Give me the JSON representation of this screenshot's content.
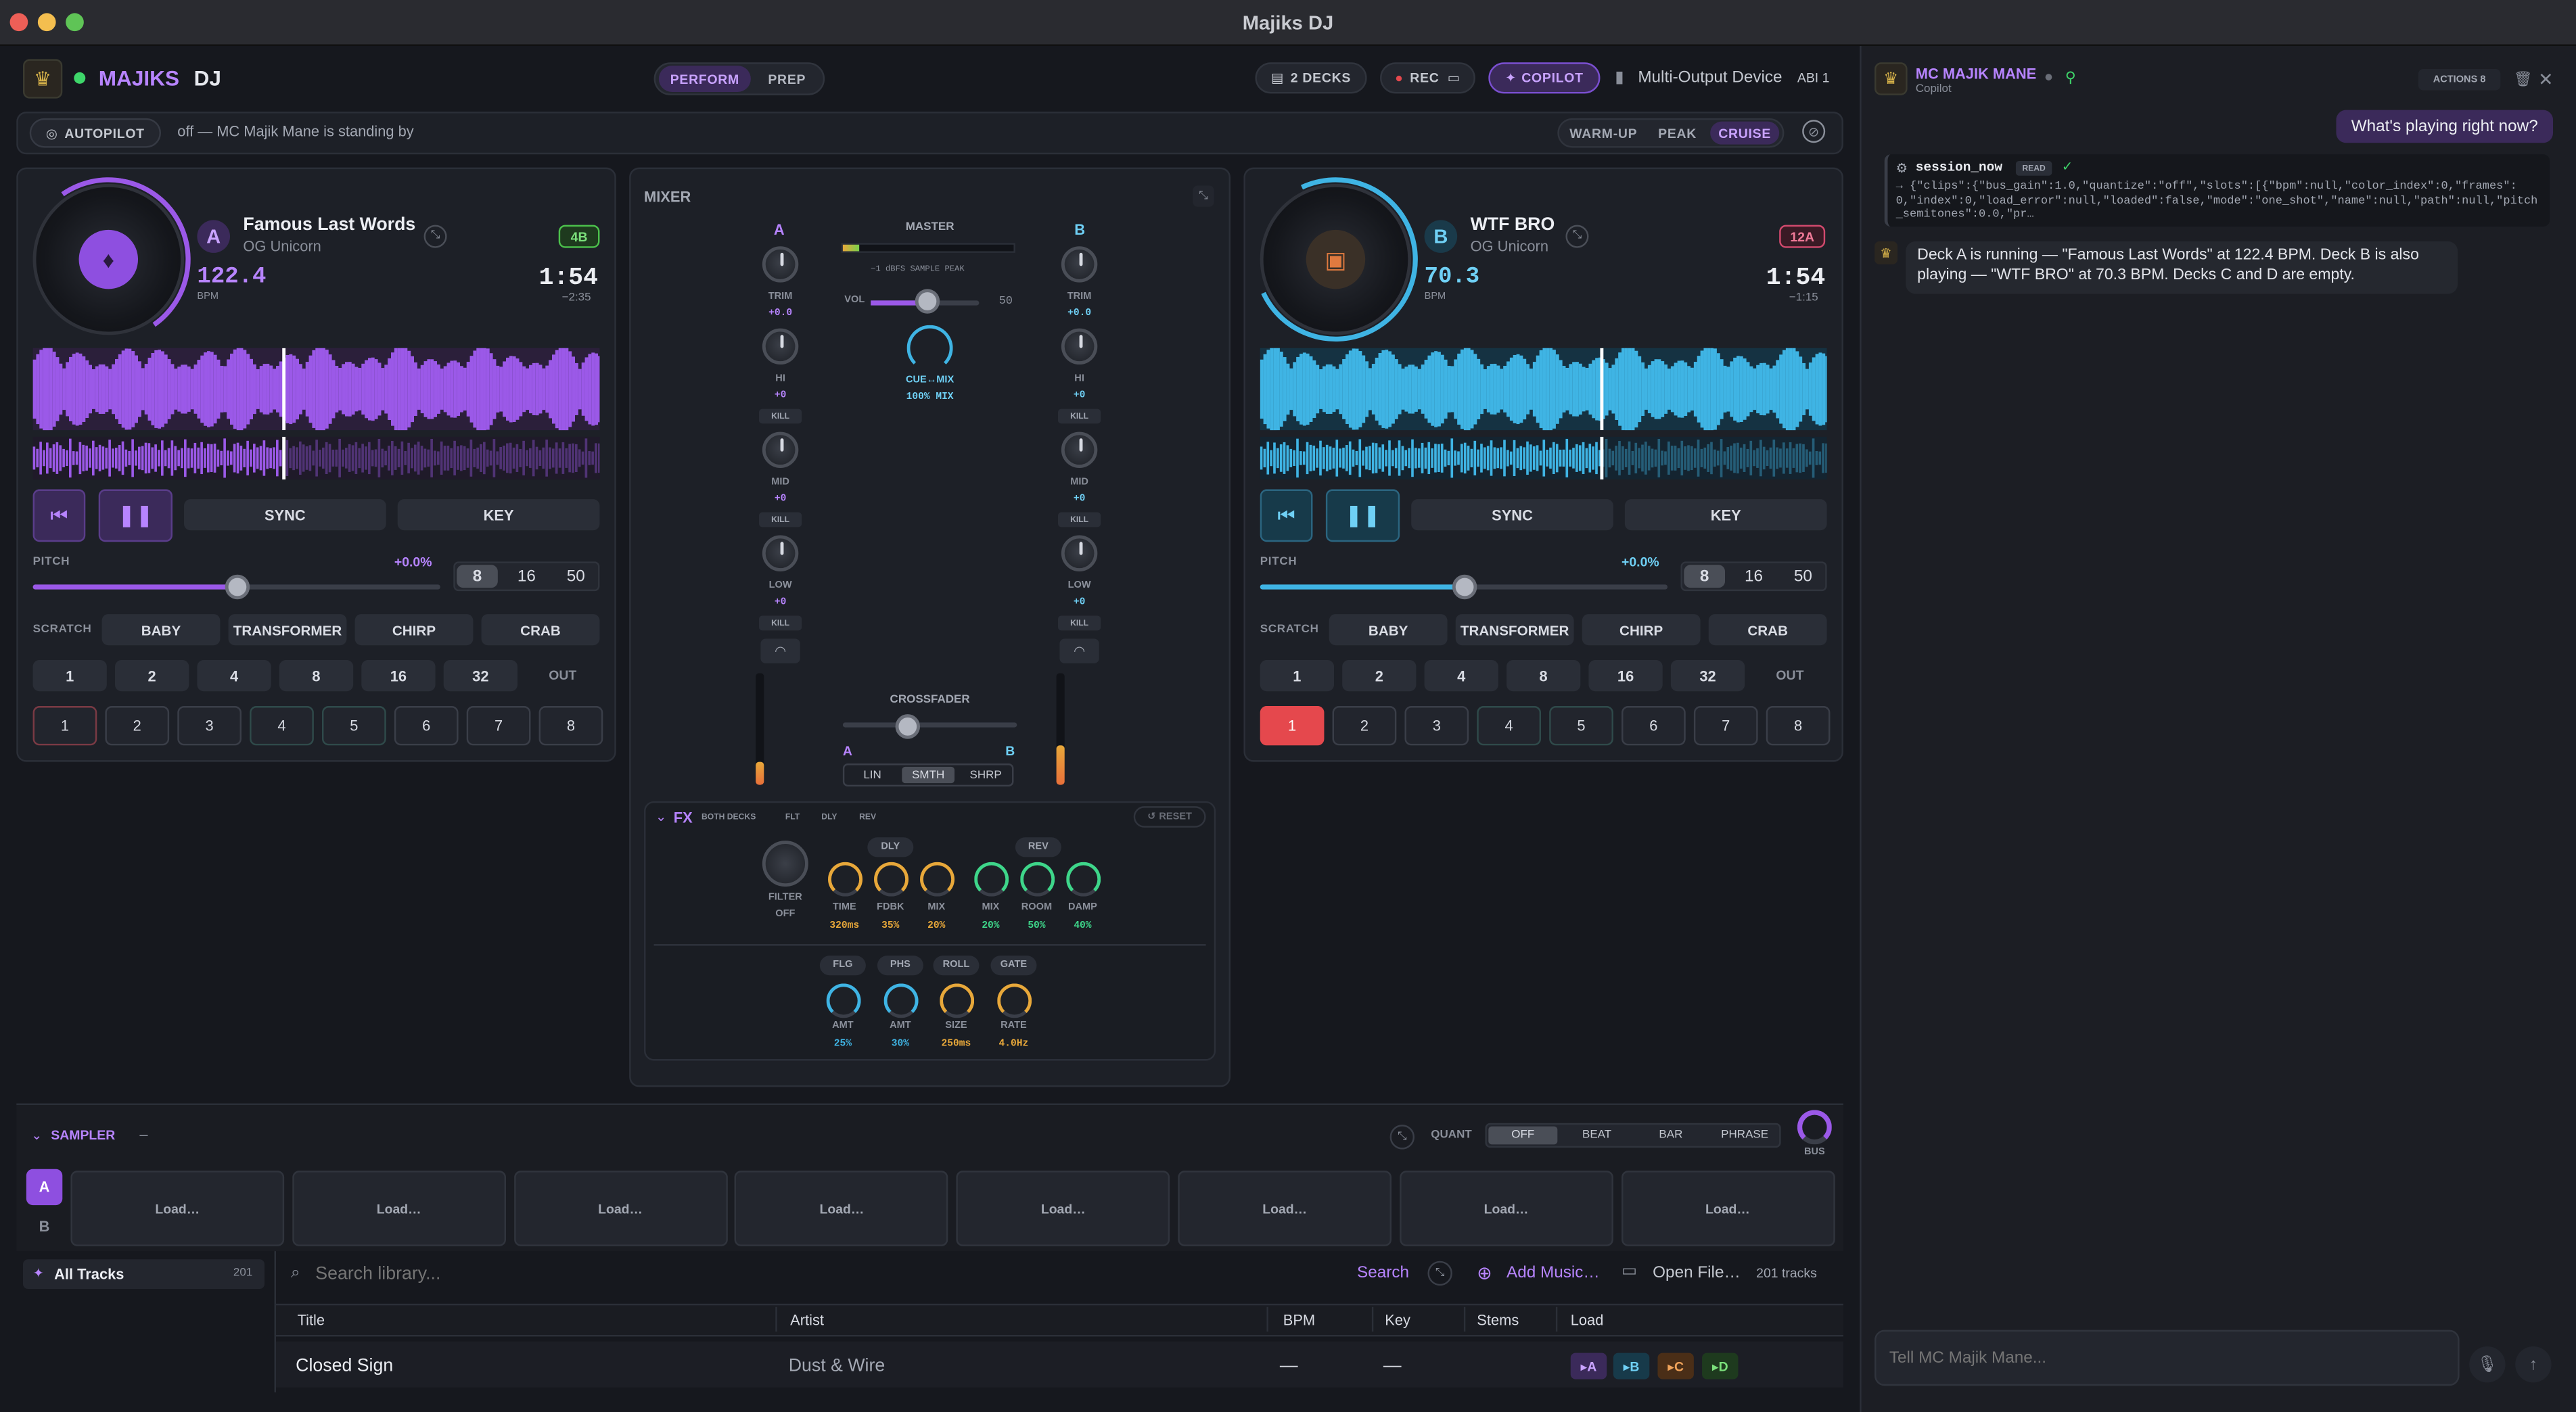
{
  "window": {
    "title": "Majiks DJ"
  },
  "header": {
    "brand": "MAJIKS",
    "brand2": "DJ",
    "mode_perform": "PERFORM",
    "mode_prep": "PREP",
    "decks": "2 DECKS",
    "rec": "REC",
    "copilot": "COPILOT",
    "device": "Multi-Output Device",
    "abi": "ABI 1"
  },
  "autopilot": {
    "label": "AUTOPILOT",
    "status": "off — MC Majik Mane is standing by",
    "modes": [
      "WARM-UP",
      "PEAK",
      "CRUISE"
    ]
  },
  "deckA": {
    "letter": "A",
    "title": "Famous Last Words",
    "artist": "OG Unicorn",
    "key": "4B",
    "bpm": "122.4",
    "bpm_label": "BPM",
    "time": "1:54",
    "remaining": "−2:35",
    "color": "#9b59e8",
    "sync": "SYNC",
    "key_btn": "KEY",
    "pitch_label": "PITCH",
    "pitch_val": "+0.0%",
    "ranges": [
      "8",
      "16",
      "50"
    ],
    "scratch_label": "SCRATCH",
    "scratch": [
      "BABY",
      "TRANSFORMER",
      "CHIRP",
      "CRAB"
    ],
    "loops": [
      "1",
      "2",
      "4",
      "8",
      "16",
      "32",
      "OUT"
    ],
    "cues": [
      "1",
      "2",
      "3",
      "4",
      "5",
      "6",
      "7",
      "8"
    ],
    "progress": 0.44,
    "pitch_pos": 0.5
  },
  "deckB": {
    "letter": "B",
    "title": "WTF BRO",
    "artist": "OG Unicorn",
    "key": "12A",
    "bpm": "70.3",
    "bpm_label": "BPM",
    "time": "1:54",
    "remaining": "−1:15",
    "color": "#3fb4e4",
    "sync": "SYNC",
    "key_btn": "KEY",
    "pitch_label": "PITCH",
    "pitch_val": "+0.0%",
    "ranges": [
      "8",
      "16",
      "50"
    ],
    "scratch_label": "SCRATCH",
    "scratch": [
      "BABY",
      "TRANSFORMER",
      "CHIRP",
      "CRAB"
    ],
    "loops": [
      "1",
      "2",
      "4",
      "8",
      "16",
      "32",
      "OUT"
    ],
    "cues": [
      "1",
      "2",
      "3",
      "4",
      "5",
      "6",
      "7",
      "8"
    ],
    "progress": 0.6,
    "pitch_pos": 0.5
  },
  "mixer": {
    "title": "MIXER",
    "a": "A",
    "b": "B",
    "master": "MASTER",
    "dbfs": "−1 dBFS SAMPLE PEAK",
    "vol": "VOL",
    "vol_val": "50",
    "cue_mix": "CUE↔MIX",
    "cue_mix_val": "100% MIX",
    "trim": "TRIM",
    "trim_val": "+0.0",
    "hi": "HI",
    "mid": "MID",
    "low": "LOW",
    "eq_val": "+0",
    "kill": "KILL",
    "crossfader": "CROSSFADER",
    "curves": [
      "LIN",
      "SMTH",
      "SHRP"
    ]
  },
  "fx": {
    "title": "FX",
    "tabs": [
      "BOTH DECKS",
      "FLT",
      "DLY",
      "REV"
    ],
    "reset": "RESET",
    "filter": "FILTER",
    "filter_val": "OFF",
    "dly": "DLY",
    "rev": "REV",
    "knobs1": [
      {
        "l": "TIME",
        "v": "320ms"
      },
      {
        "l": "FDBK",
        "v": "35%"
      },
      {
        "l": "MIX",
        "v": "20%"
      },
      {
        "l": "MIX",
        "v": "20%"
      },
      {
        "l": "ROOM",
        "v": "50%"
      },
      {
        "l": "DAMP",
        "v": "40%"
      }
    ],
    "groups2": [
      "FLG",
      "PHS",
      "ROLL",
      "GATE"
    ],
    "knobs2": [
      {
        "l": "AMT",
        "v": "25%"
      },
      {
        "l": "AMT",
        "v": "30%"
      },
      {
        "l": "SIZE",
        "v": "250ms"
      },
      {
        "l": "RATE",
        "v": "4.0Hz"
      }
    ]
  },
  "sampler": {
    "title": "SAMPLER",
    "dash": "–",
    "quant": "QUANT",
    "quant_opts": [
      "OFF",
      "BEAT",
      "BAR",
      "PHRASE"
    ],
    "bus": "BUS",
    "banks": [
      "A",
      "B"
    ],
    "slots": [
      "Load…",
      "Load…",
      "Load…",
      "Load…",
      "Load…",
      "Load…",
      "Load…",
      "Load…"
    ]
  },
  "library": {
    "all_tracks": "All Tracks",
    "count": "201",
    "search_placeholder": "Search library...",
    "search_btn": "Search",
    "add_music": "Add Music…",
    "open_file": "Open File…",
    "tracks": "201 tracks",
    "cols": [
      "Title",
      "Artist",
      "BPM",
      "Key",
      "Stems",
      "Load"
    ],
    "rows": [
      {
        "title": "Closed Sign",
        "artist": "Dust & Wire",
        "bpm": "—",
        "key": "—",
        "loads": [
          "▸A",
          "▸B",
          "▸C",
          "▸D"
        ]
      }
    ]
  },
  "copilot": {
    "name": "MC MAJIK MANE",
    "sub": "Copilot",
    "actions": "ACTIONS 8",
    "user_msg": "What's playing right now?",
    "tool": "session_now",
    "tool_badge": "READ",
    "tool_json": "→ {\"clips\":{\"bus_gain\":1.0,\"quantize\":\"off\",\"slots\":[{\"bpm\":null,\"color_index\":0,\"frames\":0,\"index\":0,\"load_error\":null,\"loaded\":false,\"mode\":\"one_shot\",\"name\":null,\"path\":null,\"pitch_semitones\":0.0,\"pr…",
    "reply": "Deck A is running — \"Famous Last Words\" at 122.4 BPM. Deck B is also playing — \"WTF BRO\" at 70.3 BPM. Decks C and D are empty.",
    "input_placeholder": "Tell MC Majik Mane..."
  }
}
